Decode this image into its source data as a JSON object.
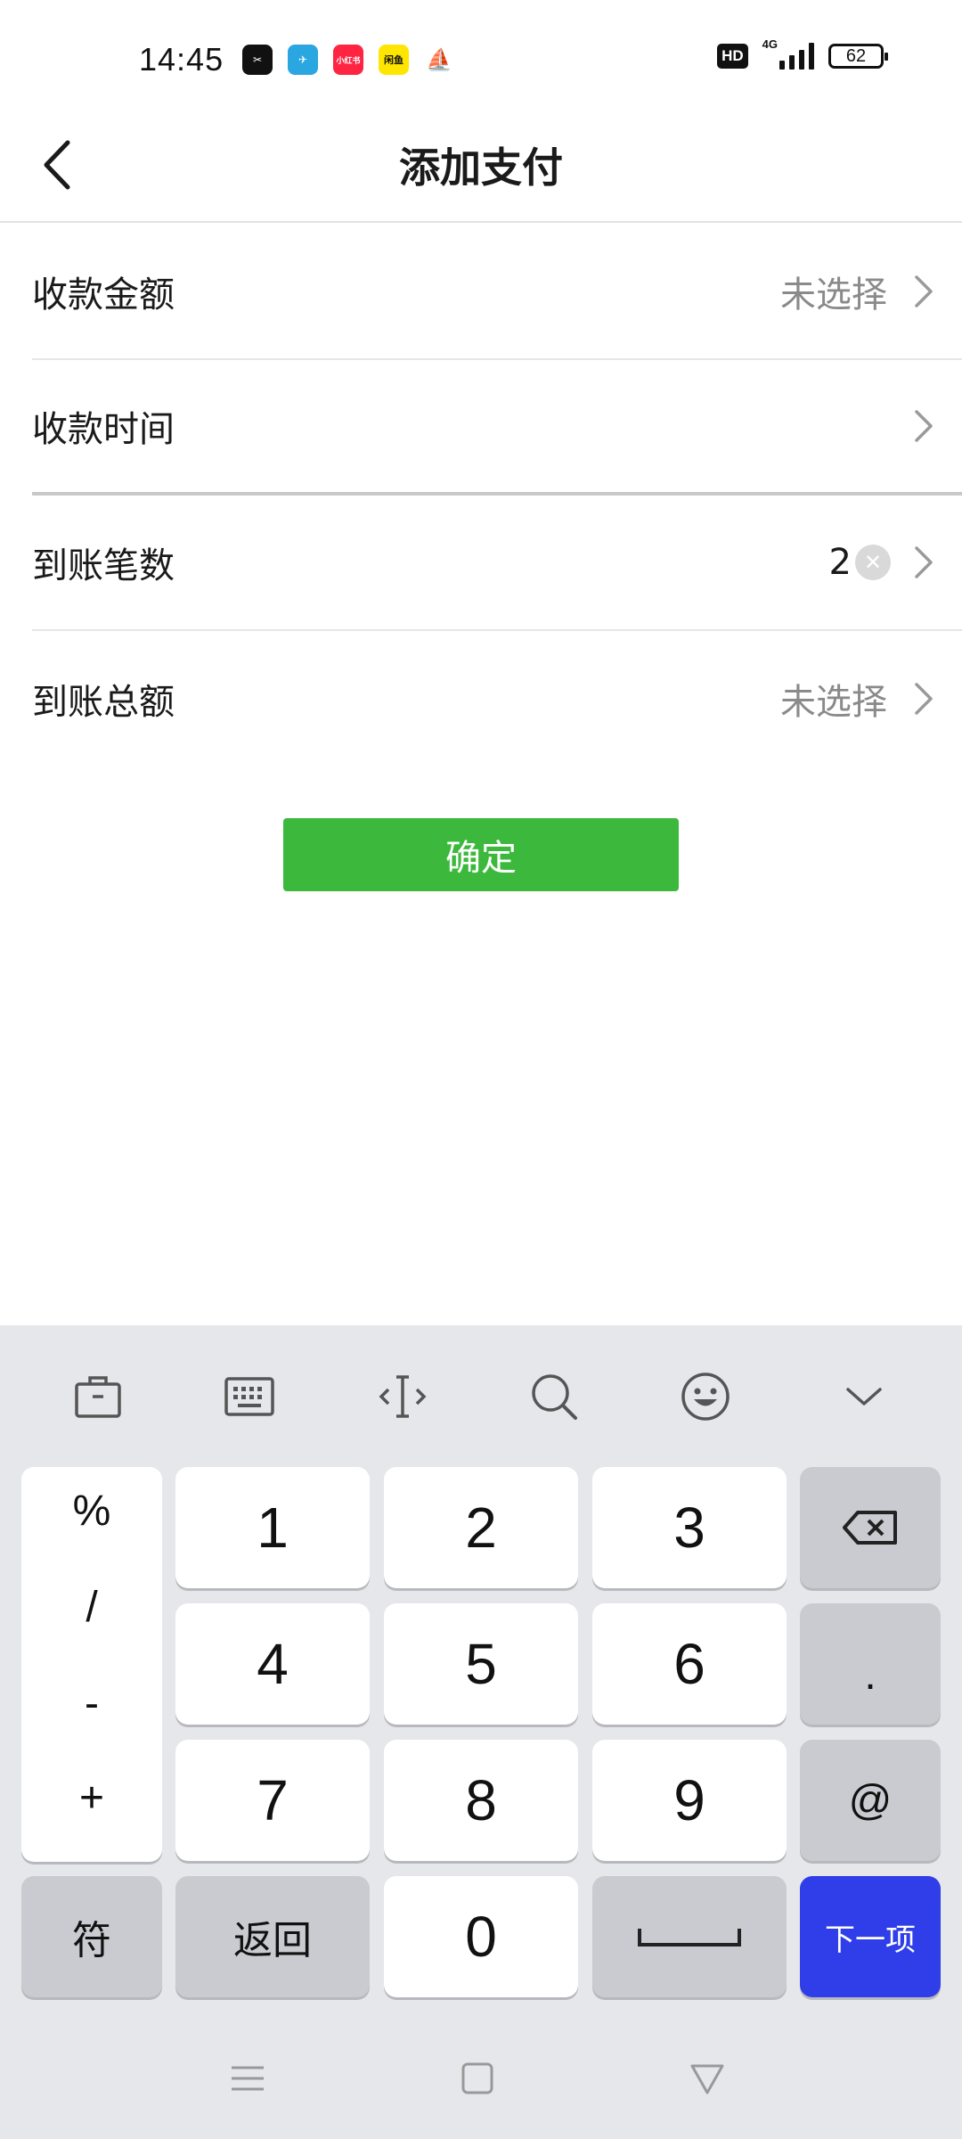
{
  "status_bar": {
    "time": "14:45",
    "hd": "HD",
    "network": "4G",
    "battery": "62",
    "apps": [
      {
        "icon": "capcut-icon",
        "color": "#111111",
        "text": "✂"
      },
      {
        "icon": "telegram-icon",
        "color": "#2aa6e0",
        "text": "✈"
      },
      {
        "icon": "xiaohongshu-icon",
        "color": "#ff2442",
        "text": "小红书"
      },
      {
        "icon": "xianyu-icon",
        "color": "#ffe600",
        "text": "闲鱼"
      },
      {
        "icon": "game-icon",
        "color": "#ffffff",
        "text": "⛵"
      }
    ]
  },
  "nav": {
    "title": "添加支付"
  },
  "rows": [
    {
      "label": "收款金额",
      "value": "未选择"
    },
    {
      "label": "收款时间",
      "value": ""
    },
    {
      "label": "到账笔数",
      "input": "2"
    },
    {
      "label": "到账总额",
      "value": "未选择"
    }
  ],
  "confirm_label": "确定",
  "keyboard": {
    "symbols": [
      "%",
      "/",
      "-",
      "+"
    ],
    "digits": [
      "1",
      "2",
      "3",
      "4",
      "5",
      "6",
      "7",
      "8",
      "9",
      "0"
    ],
    "dot": ".",
    "at": "@",
    "symbol_key": "符",
    "back_key": "返回",
    "next_key": "下一项",
    "toolbar": [
      "toolbox-icon",
      "keyboard-icon",
      "cursor-icon",
      "search-icon",
      "emoji-icon",
      "collapse-icon"
    ]
  },
  "colors": {
    "confirm": "#3cb93c",
    "next": "#2f3ee9",
    "keyboard_bg": "#e6e7eb"
  }
}
